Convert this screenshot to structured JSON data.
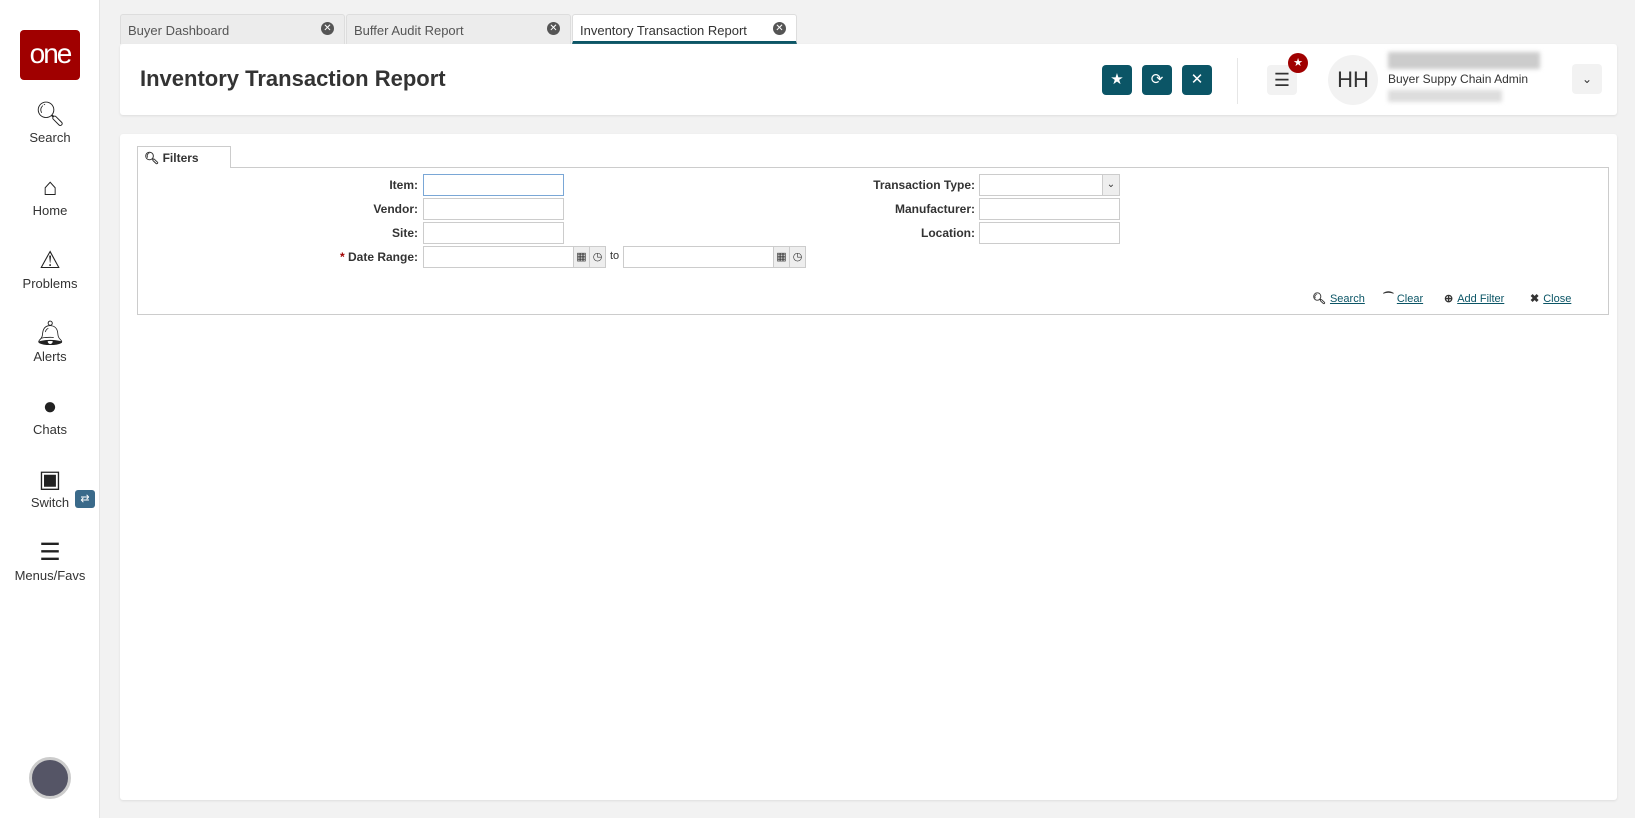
{
  "sidebar": {
    "logo": "one",
    "items": [
      {
        "label": "Search",
        "icon": "search-icon"
      },
      {
        "label": "Home",
        "icon": "home-icon"
      },
      {
        "label": "Problems",
        "icon": "warning-icon"
      },
      {
        "label": "Alerts",
        "icon": "bell-icon"
      },
      {
        "label": "Chats",
        "icon": "chat-icon"
      },
      {
        "label": "Switch",
        "icon": "switch-icon"
      },
      {
        "label": "Menus/Favs",
        "icon": "menu-icon"
      }
    ]
  },
  "tabs": [
    {
      "label": "Buyer Dashboard"
    },
    {
      "label": "Buffer Audit Report"
    },
    {
      "label": "Inventory Transaction Report"
    }
  ],
  "header": {
    "title": "Inventory Transaction Report",
    "avatar_initials": "HH",
    "role": "Buyer Suppy Chain Admin"
  },
  "filters": {
    "tab_label": "Filters",
    "item": "Item:",
    "vendor": "Vendor:",
    "site": "Site:",
    "date_range": "Date Range:",
    "required_mark": "*",
    "to": "to",
    "transaction_type": "Transaction Type:",
    "manufacturer": "Manufacturer:",
    "location": "Location:",
    "search": "Search",
    "clear": "Clear",
    "add_filter": "Add Filter",
    "close": "Close"
  },
  "colors": {
    "brand": "#a00000",
    "accent": "#0b5566"
  }
}
